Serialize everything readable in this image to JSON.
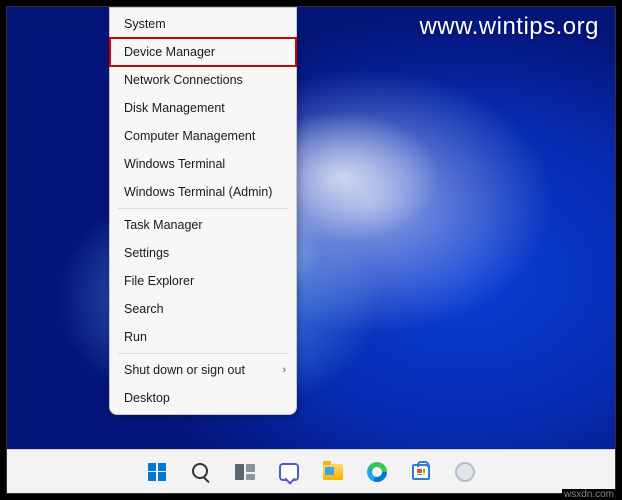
{
  "watermark": "www.wintips.org",
  "credit": "wsxdn.com",
  "menu": {
    "groups": [
      [
        {
          "label": "System",
          "highlight": false,
          "submenu": false
        },
        {
          "label": "Device Manager",
          "highlight": true,
          "submenu": false
        },
        {
          "label": "Network Connections",
          "highlight": false,
          "submenu": false
        },
        {
          "label": "Disk Management",
          "highlight": false,
          "submenu": false
        },
        {
          "label": "Computer Management",
          "highlight": false,
          "submenu": false
        },
        {
          "label": "Windows Terminal",
          "highlight": false,
          "submenu": false
        },
        {
          "label": "Windows Terminal (Admin)",
          "highlight": false,
          "submenu": false
        }
      ],
      [
        {
          "label": "Task Manager",
          "highlight": false,
          "submenu": false
        },
        {
          "label": "Settings",
          "highlight": false,
          "submenu": false
        },
        {
          "label": "File Explorer",
          "highlight": false,
          "submenu": false
        },
        {
          "label": "Search",
          "highlight": false,
          "submenu": false
        },
        {
          "label": "Run",
          "highlight": false,
          "submenu": false
        }
      ],
      [
        {
          "label": "Shut down or sign out",
          "highlight": false,
          "submenu": true
        },
        {
          "label": "Desktop",
          "highlight": false,
          "submenu": false
        }
      ]
    ]
  },
  "taskbar": {
    "items": [
      {
        "name": "start-button",
        "icon": "windows-logo-icon"
      },
      {
        "name": "search-button",
        "icon": "search-icon"
      },
      {
        "name": "task-view-button",
        "icon": "task-view-icon"
      },
      {
        "name": "chat-button",
        "icon": "chat-icon"
      },
      {
        "name": "file-explorer-button",
        "icon": "folder-icon"
      },
      {
        "name": "edge-button",
        "icon": "edge-icon"
      },
      {
        "name": "store-button",
        "icon": "store-icon"
      },
      {
        "name": "app-button",
        "icon": "circle-icon"
      }
    ]
  }
}
